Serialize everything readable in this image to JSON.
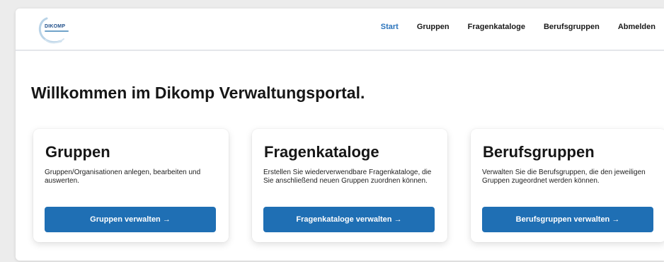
{
  "logo": {
    "text": "DIKOMP"
  },
  "nav": {
    "items": [
      {
        "label": "Start"
      },
      {
        "label": "Gruppen"
      },
      {
        "label": "Fragenkataloge"
      },
      {
        "label": "Berufsgruppen"
      },
      {
        "label": "Abmelden"
      }
    ],
    "active": "Start"
  },
  "main": {
    "title": "Willkommen im Dikomp Verwaltungsportal.",
    "cards": [
      {
        "title": "Gruppen",
        "description": "Gruppen/Organisationen anlegen, bearbeiten und auswerten.",
        "button": "Gruppen verwalten →"
      },
      {
        "title": "Fragenkataloge",
        "description": "Erstellen Sie wiederverwendbare Fragenkataloge, die Sie anschließend neuen Gruppen zuordnen können.",
        "button": "Fragenkataloge verwalten →"
      },
      {
        "title": "Berufsgruppen",
        "description": "Verwalten Sie die Berufsgruppen, die den jeweiligen Gruppen zugeordnet werden können.",
        "button": "Berufsgruppen verwalten →"
      }
    ]
  },
  "colors": {
    "accent": "#2b74bc",
    "button": "#1f6fb4",
    "logo": "#1f4f8a"
  }
}
